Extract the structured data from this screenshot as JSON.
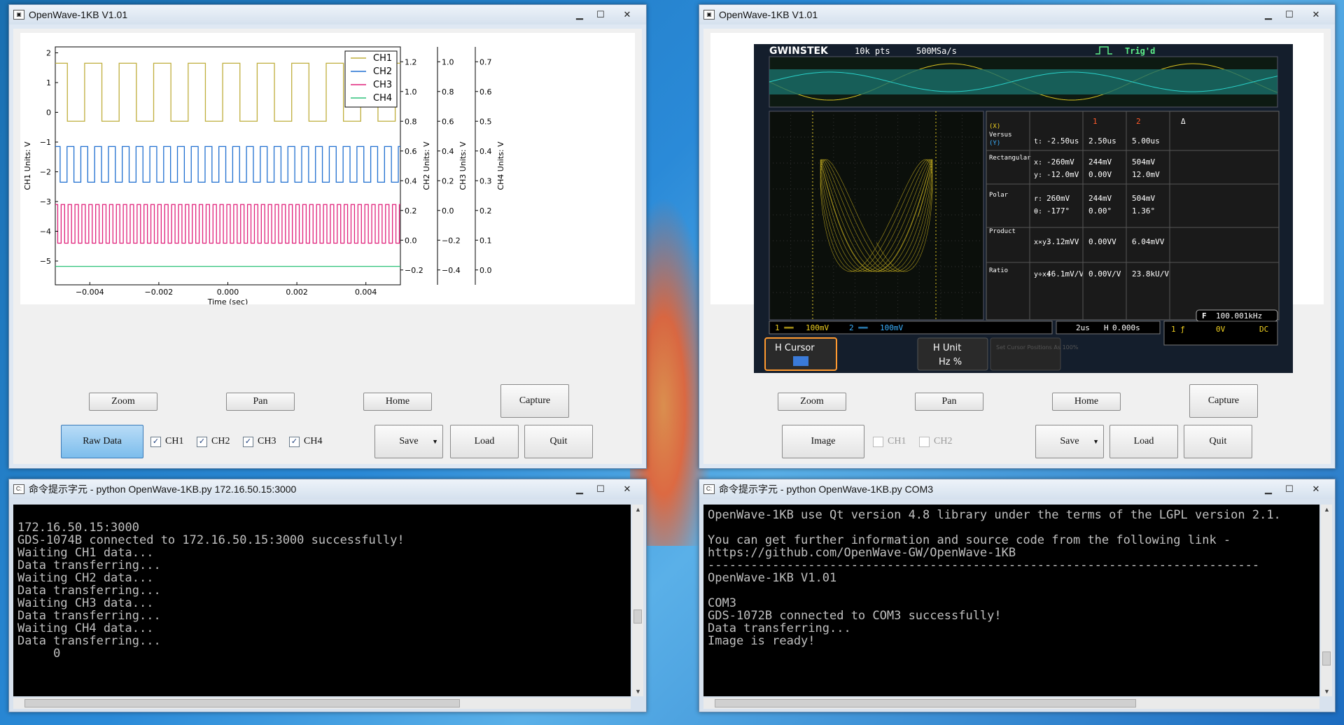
{
  "windows": {
    "left_plot": {
      "title": "OpenWave-1KB V1.01",
      "buttons": {
        "zoom": "Zoom",
        "pan": "Pan",
        "home": "Home",
        "capture": "Capture",
        "raw_data": "Raw Data",
        "save": "Save",
        "load": "Load",
        "quit": "Quit"
      },
      "checkboxes": [
        {
          "label": "CH1",
          "checked": true
        },
        {
          "label": "CH2",
          "checked": true
        },
        {
          "label": "CH3",
          "checked": true
        },
        {
          "label": "CH4",
          "checked": true
        }
      ]
    },
    "right_plot": {
      "title": "OpenWave-1KB V1.01",
      "buttons": {
        "zoom": "Zoom",
        "pan": "Pan",
        "home": "Home",
        "capture": "Capture",
        "image": "Image",
        "save": "Save",
        "load": "Load",
        "quit": "Quit"
      },
      "checkboxes": [
        {
          "label": "CH1",
          "checked": false
        },
        {
          "label": "CH2",
          "checked": false
        }
      ]
    },
    "left_console": {
      "title": "命令提示字元 - python  OpenWave-1KB.py 172.16.50.15:3000",
      "lines": [
        "",
        "172.16.50.15:3000",
        "GDS-1074B connected to 172.16.50.15:3000 successfully!",
        "Waiting CH1 data...",
        "Data transferring...",
        "Waiting CH2 data...",
        "Data transferring...",
        "Waiting CH3 data...",
        "Data transferring...",
        "Waiting CH4 data...",
        "Data transferring...",
        "     0"
      ]
    },
    "right_console": {
      "title": "命令提示字元 - python  OpenWave-1KB.py COM3",
      "lines": [
        "OpenWave-1KB use Qt version 4.8 library under the terms of the LGPL version 2.1.",
        "",
        "You can get further information and source code from the following link -",
        "https://github.com/OpenWave-GW/OpenWave-1KB",
        "-----------------------------------------------------------------------------",
        "OpenWave-1KB V1.01",
        "",
        "COM3",
        "GDS-1072B connected to COM3 successfully!",
        "Data transferring...",
        "Image is ready!"
      ]
    }
  },
  "chart_data": {
    "type": "line",
    "x": [
      -0.005,
      0.005
    ],
    "xlabel": "Time (sec)",
    "xticks": [
      "−0.004",
      "−0.002",
      "0.000",
      "0.002",
      "0.004"
    ],
    "xtick_values": [
      -0.004,
      -0.002,
      0.0,
      0.002,
      0.004
    ],
    "axes": [
      {
        "label": "CH1 Units: V",
        "ticks": [
          "−5",
          "−4",
          "−3",
          "−2",
          "−1",
          "0",
          "1",
          "2"
        ],
        "ylim": [
          -5.8,
          2.2
        ]
      },
      {
        "label": "CH2 Units: V",
        "ticks": [
          "−0.2",
          "0.0",
          "0.2",
          "0.4",
          "0.6",
          "0.8",
          "1.0",
          "1.2"
        ],
        "ylim": [
          -0.3,
          1.3
        ]
      },
      {
        "label": "CH3 Units: V",
        "ticks": [
          "−0.4",
          "−0.2",
          "0.0",
          "0.2",
          "0.4",
          "0.6",
          "0.8",
          "1.0"
        ],
        "ylim": [
          -0.5,
          1.1
        ]
      },
      {
        "label": "CH4 Units: V",
        "ticks": [
          "0.0",
          "0.1",
          "0.2",
          "0.3",
          "0.4",
          "0.5",
          "0.6",
          "0.7"
        ],
        "ylim": [
          -0.05,
          0.75
        ]
      }
    ],
    "series": [
      {
        "name": "CH1",
        "color": "#bfae3c",
        "low": -0.3,
        "high": 1.65,
        "periods": 10
      },
      {
        "name": "CH2",
        "color": "#1f6fd0",
        "low": -2.35,
        "high": -1.15,
        "periods": 25
      },
      {
        "name": "CH3",
        "color": "#e0207a",
        "low": -4.4,
        "high": -3.1,
        "periods": 50
      },
      {
        "name": "CH4",
        "color": "#2ec27a",
        "low": -5.18,
        "high": -5.18,
        "periods": 0
      }
    ],
    "legend": "top-right"
  },
  "scope_screen": {
    "brand": "GWINSTEK",
    "points": "10k pts",
    "rate": "500MSa/s",
    "trig": "Trig'd",
    "cursor_table": {
      "headers": [
        "1",
        "2",
        "Δ"
      ],
      "versus": [
        "(X)",
        "Versus",
        "(Y)"
      ],
      "t": [
        "t:",
        "-2.50us",
        "2.50us",
        "5.00us"
      ],
      "rect_label": "Rectangular",
      "x": [
        "x:",
        "-260mV",
        "244mV",
        "504mV"
      ],
      "y": [
        "y:",
        "-12.0mV",
        "0.00V",
        "12.0mV"
      ],
      "polar_label": "Polar",
      "r": [
        "r:",
        "260mV",
        "244mV",
        "504mV"
      ],
      "theta": [
        "θ:",
        "-177°",
        "0.00°",
        "1.36°"
      ],
      "product_label": "Product",
      "xy": [
        "x×y:",
        "3.12mVV",
        "0.00VV",
        "6.04mVV"
      ],
      "ratio_label": "Ratio",
      "yx": [
        "y÷x:",
        "46.1mV/V",
        "0.00V/V",
        "23.8kU/V"
      ]
    },
    "status": {
      "ch1": "100mV",
      "ch2": "100mV",
      "timebase": "2us",
      "h_pos": "0.000s",
      "freq": "100.001kHz",
      "trig_level": "0V",
      "coupling": "DC"
    },
    "softkeys": {
      "h_cursor": "H Cursor",
      "h_unit": "H Unit",
      "h_unit_opts": "Hz %",
      "set_cursor": "Set Cursor Positions As 100%"
    }
  }
}
